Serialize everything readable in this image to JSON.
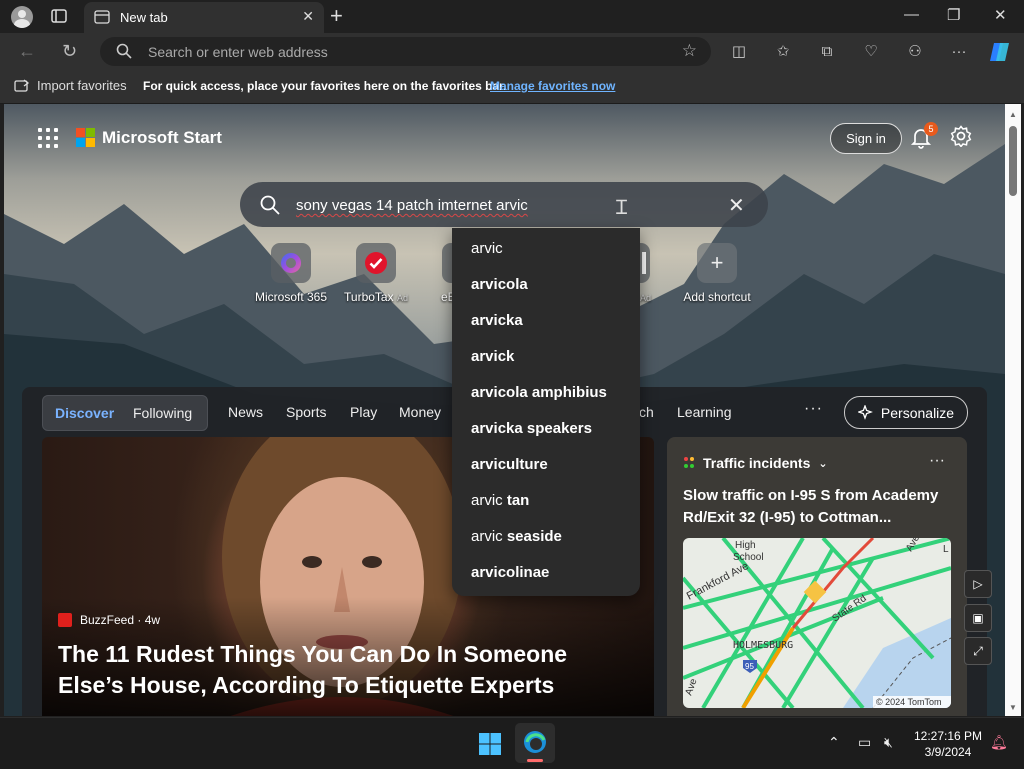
{
  "browser": {
    "tab_title": "New tab",
    "address_placeholder": "Search or enter web address",
    "favorites": {
      "import_label": "Import favorites",
      "tip": "For quick access, place your favorites here on the favorites bar.",
      "manage_link": "Manage favorites now"
    }
  },
  "start": {
    "brand": "Microsoft Start",
    "sign_in": "Sign in",
    "notification_count": "5",
    "search_query": "sony vegas 14 patch imternet arvic",
    "shortcuts": [
      {
        "label": "Microsoft 365",
        "ad": ""
      },
      {
        "label": "TurboTax",
        "ad": "Ad"
      },
      {
        "label": "eB",
        "ad": ""
      },
      {
        "label": "",
        "ad": "Ad"
      },
      {
        "label": "Add shortcut",
        "ad": ""
      }
    ],
    "suggestions": [
      {
        "prefix": "arvic",
        "bold": ""
      },
      {
        "prefix": "",
        "bold": "arvicola"
      },
      {
        "prefix": "",
        "bold": "arvicka"
      },
      {
        "prefix": "",
        "bold": "arvick"
      },
      {
        "prefix": "",
        "bold": "arvicola amphibius"
      },
      {
        "prefix": "",
        "bold": "arvicka speakers"
      },
      {
        "prefix": "",
        "bold": "arviculture"
      },
      {
        "prefix": "arvic ",
        "bold": "tan"
      },
      {
        "prefix": "arvic ",
        "bold": "seaside"
      },
      {
        "prefix": "",
        "bold": "arvicolinae"
      }
    ],
    "feed_nav": {
      "discover": "Discover",
      "following": "Following",
      "items": [
        "News",
        "Sports",
        "Play",
        "Money",
        "ch",
        "Learning"
      ],
      "more": "···",
      "personalize": "Personalize"
    },
    "hero": {
      "source": "BuzzFeed · 4w",
      "title": "The 11 Rudest Things You Can Do In Someone Else’s House, According To Etiquette Experts"
    },
    "traffic": {
      "header": "Traffic incidents",
      "title": "Slow traffic on I-95 S from Academy Rd/Exit 32 (I-95) to Cottman...",
      "map_labels": [
        "High School",
        "Frankford Ave",
        "State Rd",
        "HOLMESBURG",
        "95",
        "Ave",
        "Ave",
        "L"
      ],
      "copyright": "© 2024 TomTom"
    }
  },
  "taskbar": {
    "time": "12:27:16 PM",
    "date": "3/9/2024"
  },
  "colors": {
    "accent_link": "#6fb4ff",
    "discover": "#7ab3ff",
    "badge": "#e85a1c"
  }
}
